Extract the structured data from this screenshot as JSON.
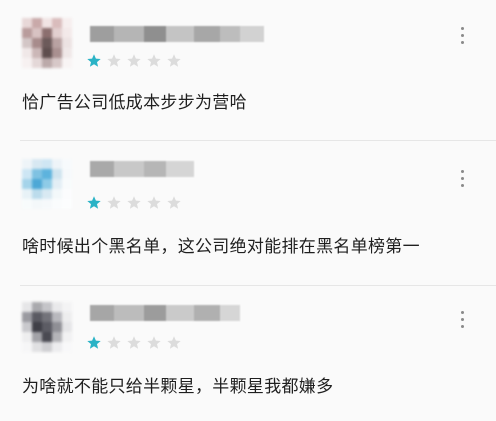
{
  "reviews": [
    {
      "rating": 1,
      "max_rating": 5,
      "text": "恰广告公司低成本步步为营哈",
      "avatar_colors": [
        "#e8d8d8",
        "#c9a9a9",
        "#f1e4e4",
        "#d9bcbc",
        "#f6eeee",
        "#b99c9c",
        "#d8c2c2",
        "#8c6f6f",
        "#e2cfcf",
        "#f3e9e9",
        "#d3c6c6",
        "#a88c8c",
        "#6c5a5a",
        "#b9a2a2",
        "#ece2e2",
        "#f0e8e8",
        "#cbb7b7",
        "#5f4e4e",
        "#a99090",
        "#efe7e7",
        "#f7f1f1",
        "#e4d8d8",
        "#bcaaaa",
        "#d7c8c8",
        "#f8f4f4"
      ],
      "username_colors": [
        "#9e9e9e",
        "#b5b5b5",
        "#8f8f8f",
        "#c4c4c4",
        "#a7a7a7",
        "#bdbdbd",
        "#d2d2d2"
      ]
    },
    {
      "rating": 1,
      "max_rating": 5,
      "text": "啥时候出个黑名单，这公司绝对能排在黑名单榜第一",
      "avatar_colors": [
        "#eef4f8",
        "#d7e8f2",
        "#cfe6f3",
        "#eef4f8",
        "#f7fafc",
        "#cde6f4",
        "#7fc2e2",
        "#5db3dd",
        "#cfe4ef",
        "#f6f9fb",
        "#a5d4ea",
        "#4da8d6",
        "#8ecbe7",
        "#e3eef5",
        "#f8fbfc",
        "#e8f2f7",
        "#bcdcec",
        "#d8e9f2",
        "#f3f8fa",
        "#fbfcfd",
        "#f8fbfc",
        "#f4f8fa",
        "#f6f9fb",
        "#fafcfd",
        "#fcfdfe"
      ],
      "username_colors": [
        "#a9a9a9",
        "#c8c8c8",
        "#b6b6b6",
        "#d5d5d5"
      ]
    },
    {
      "rating": 1,
      "max_rating": 5,
      "text": "为啥就不能只给半颗星，半颗星我都嫌多",
      "avatar_colors": [
        "#e6e6e8",
        "#a9a9ad",
        "#c4c4c8",
        "#e9e9eb",
        "#f3f3f4",
        "#9a9aa0",
        "#5a5a62",
        "#73737a",
        "#b8b8bd",
        "#ededee",
        "#c9c9cd",
        "#3f3f47",
        "#5c5c64",
        "#8f8f95",
        "#e5e5e7",
        "#eeeeef",
        "#a3a3a8",
        "#4a4a52",
        "#b4b4b8",
        "#f1f1f2",
        "#f6f6f7",
        "#e0e0e2",
        "#cfcfd2",
        "#ececee",
        "#f8f8f9"
      ],
      "username_colors": [
        "#a6a6a6",
        "#bcbcbc",
        "#9c9c9c",
        "#cacaca",
        "#b0b0b0",
        "#d6d6d6"
      ]
    }
  ],
  "colors": {
    "star_filled": "#2ab3c6",
    "star_empty": "#dcdcdc",
    "text": "#1f1f1f",
    "more_icon": "#8a8a8a"
  },
  "icons": {
    "more": "more-vertical-icon",
    "star": "star-icon"
  }
}
